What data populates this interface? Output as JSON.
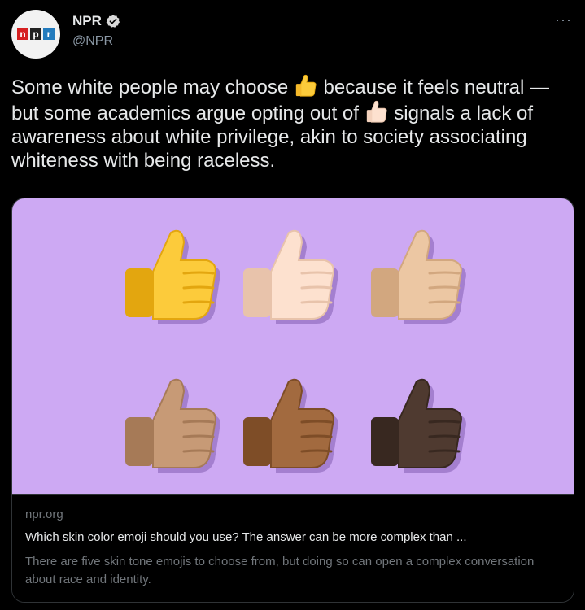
{
  "account": {
    "logo_letters": [
      "n",
      "p",
      "r"
    ],
    "name": "NPR",
    "handle": "@NPR",
    "verified": true,
    "more_label": "···"
  },
  "tweet": {
    "text_part1": "Some white people may choose ",
    "text_part2": " because it feels neutral — but some academics argue opting out of ",
    "text_part3": " signals a lack of awareness about white privilege, akin to society associating whiteness with being raceless.",
    "inline_emojis": [
      "thumbs-up-yellow",
      "thumbs-up-light"
    ]
  },
  "card": {
    "image_bg": "#cda9f3",
    "thumbs": [
      {
        "name": "thumbs-up-default-icon",
        "color": "#fccb3b",
        "shade": "#e3a60f"
      },
      {
        "name": "thumbs-up-light-icon",
        "color": "#fde1cf",
        "shade": "#e8c3ab"
      },
      {
        "name": "thumbs-up-medium-light-icon",
        "color": "#ecc7a3",
        "shade": "#d2a77f"
      },
      {
        "name": "thumbs-up-medium-icon",
        "color": "#c79a76",
        "shade": "#a67a57"
      },
      {
        "name": "thumbs-up-medium-dark-icon",
        "color": "#a26a3f",
        "shade": "#7e4d27"
      },
      {
        "name": "thumbs-up-dark-icon",
        "color": "#4f3a30",
        "shade": "#382820"
      }
    ],
    "domain": "npr.org",
    "title": "Which skin color emoji should you use? The answer can be more complex than ...",
    "description": "There are five skin tone emojis to choose from, but doing so can open a complex conversation about race and identity."
  }
}
